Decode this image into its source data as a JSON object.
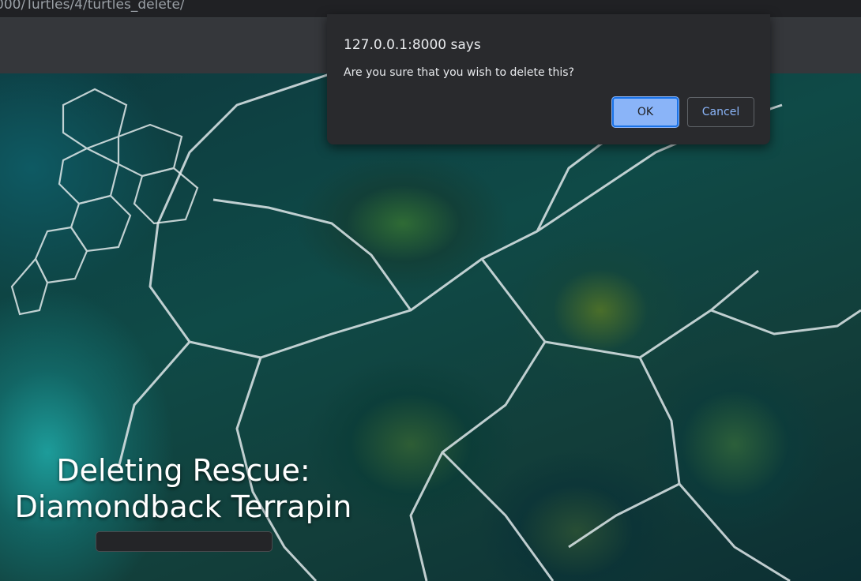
{
  "browser": {
    "url": "000/Turtles/4/turtles_delete/"
  },
  "hero": {
    "title_line1": "Deleting Rescue:",
    "title_line2": "Diamondback Terrapin"
  },
  "dialog": {
    "origin": "127.0.0.1:8000 says",
    "message": "Are you sure that you wish to delete this?",
    "ok_label": "OK",
    "cancel_label": "Cancel"
  },
  "colors": {
    "dialog_background": "#292a2d",
    "primary_button": "#8ab4f8",
    "navbar": "#35373b"
  }
}
